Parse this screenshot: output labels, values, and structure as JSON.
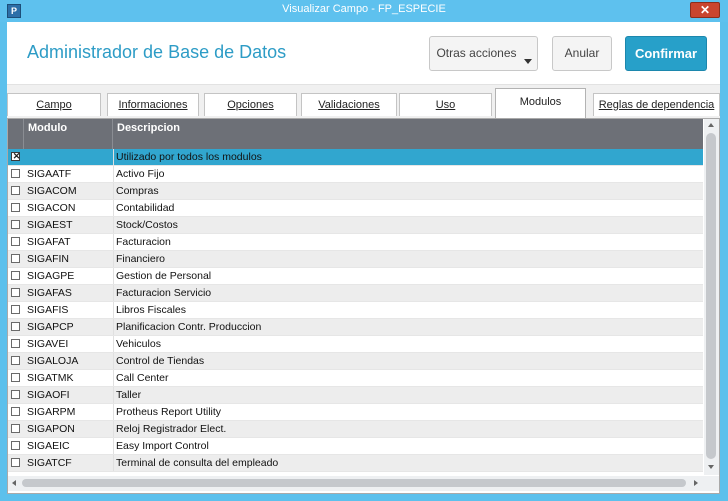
{
  "window": {
    "title": "Visualizar Campo - FP_ESPECIE",
    "close_glyph": "✕"
  },
  "header": {
    "title": "Administrador de Base de Datos",
    "otras_acciones_label": "Otras acciones",
    "anular_label": "Anular",
    "confirmar_label": "Confirmar"
  },
  "tabs": [
    {
      "label": "Campo",
      "active": false
    },
    {
      "label": "Informaciones",
      "active": false
    },
    {
      "label": "Opciones",
      "active": false
    },
    {
      "label": "Validaciones",
      "active": false
    },
    {
      "label": "Uso",
      "active": false
    },
    {
      "label": "Modulos",
      "active": true
    },
    {
      "label": "Reglas de dependencia",
      "active": false
    }
  ],
  "grid": {
    "columns": [
      "Modulo",
      "Descripcion"
    ],
    "rows": [
      {
        "checked": true,
        "modulo": "",
        "descripcion": "Utilizado por todos los modulos",
        "selected": true
      },
      {
        "checked": false,
        "modulo": "SIGAATF",
        "descripcion": "Activo Fijo"
      },
      {
        "checked": false,
        "modulo": "SIGACOM",
        "descripcion": "Compras"
      },
      {
        "checked": false,
        "modulo": "SIGACON",
        "descripcion": "Contabilidad"
      },
      {
        "checked": false,
        "modulo": "SIGAEST",
        "descripcion": "Stock/Costos"
      },
      {
        "checked": false,
        "modulo": "SIGAFAT",
        "descripcion": "Facturacion"
      },
      {
        "checked": false,
        "modulo": "SIGAFIN",
        "descripcion": "Financiero"
      },
      {
        "checked": false,
        "modulo": "SIGAGPE",
        "descripcion": "Gestion de Personal"
      },
      {
        "checked": false,
        "modulo": "SIGAFAS",
        "descripcion": "Facturacion Servicio"
      },
      {
        "checked": false,
        "modulo": "SIGAFIS",
        "descripcion": "Libros Fiscales"
      },
      {
        "checked": false,
        "modulo": "SIGAPCP",
        "descripcion": "Planificacion Contr. Produccion"
      },
      {
        "checked": false,
        "modulo": "SIGAVEI",
        "descripcion": "Vehiculos"
      },
      {
        "checked": false,
        "modulo": "SIGALOJA",
        "descripcion": "Control de Tiendas"
      },
      {
        "checked": false,
        "modulo": "SIGATMK",
        "descripcion": "Call Center"
      },
      {
        "checked": false,
        "modulo": "SIGAOFI",
        "descripcion": "Taller"
      },
      {
        "checked": false,
        "modulo": "SIGARPM",
        "descripcion": "Protheus Report Utility"
      },
      {
        "checked": false,
        "modulo": "SIGAPON",
        "descripcion": "Reloj Registrador Elect."
      },
      {
        "checked": false,
        "modulo": "SIGAEIC",
        "descripcion": "Easy Import Control"
      },
      {
        "checked": false,
        "modulo": "SIGATCF",
        "descripcion": "Terminal de consulta del empleado"
      }
    ]
  },
  "colors": {
    "accent": "#27a0c9",
    "frame": "#5ec1ee",
    "selected_row": "#31a6cf",
    "grid_header": "#6d7077"
  }
}
